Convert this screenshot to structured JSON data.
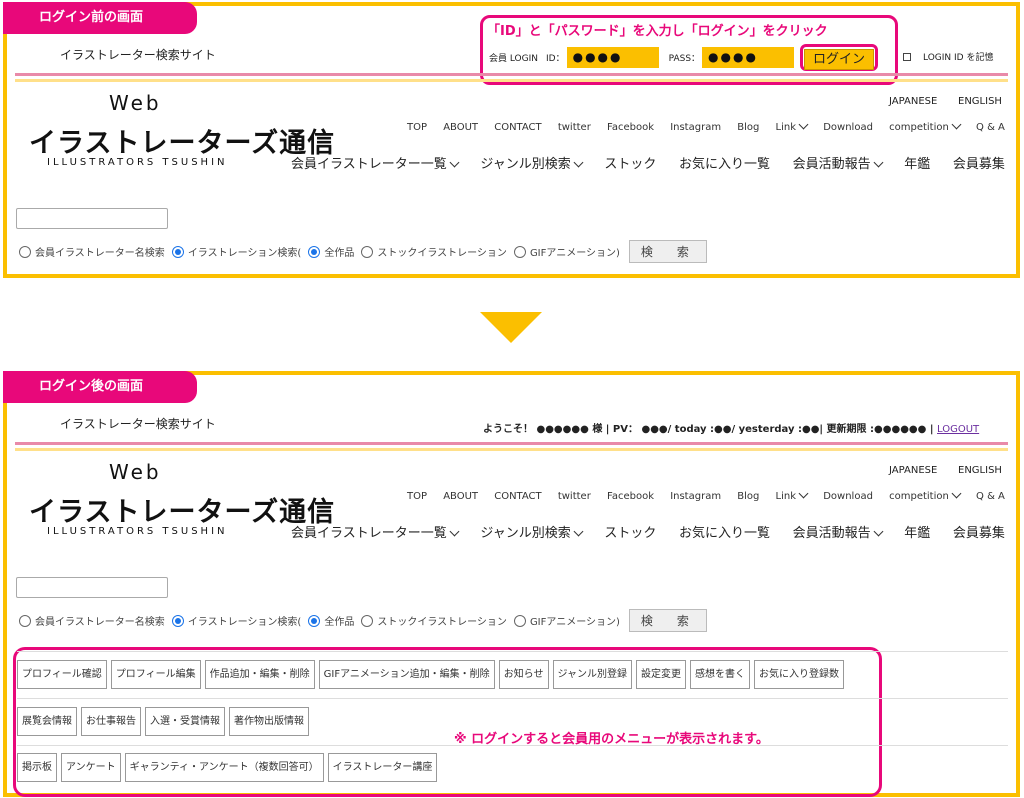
{
  "before": {
    "tag": "ログイン前の画面",
    "instruction": "「ID」と「パスワード」を入力し「ログイン」をクリック",
    "member_login_label": "会員 LOGIN",
    "id_label": "ID：",
    "id_value": "●●●●",
    "pass_label": "PASS：",
    "pass_value": "●●●●",
    "login_button": "ログイン",
    "remember_label": "LOGIN ID を記憶"
  },
  "after": {
    "tag": "ログイン後の画面",
    "welcome": "ようこそ！ ●●●●●● 様 | PV： ●●●/ today :●●/ yesterday :●●| 更新期限 :●●●●●● |",
    "logout": "LOGOUT",
    "menu_rows": [
      [
        "プロフィール確認",
        "プロフィール編集",
        "作品追加・編集・削除",
        "GIFアニメーション追加・編集・削除",
        "お知らせ",
        "ジャンル別登録",
        "設定変更",
        "感想を書く",
        "お気に入り登録数"
      ],
      [
        "展覧会情報",
        "お仕事報告",
        "入選・受賞情報",
        "著作物出版情報"
      ],
      [
        "掲示板",
        "アンケート",
        "ギャランティ・アンケート（複数回答可）",
        "イラストレーター講座"
      ]
    ],
    "note": "※ ログインすると会員用のメニューが表示されます。"
  },
  "site": {
    "tagline": "イラストレーター検索サイト",
    "logo_web": "Web",
    "logo_jp": "イラストレーターズ通信",
    "logo_en": "ILLUSTRATORS TSUSHIN",
    "lang_jp": "JAPANESE",
    "lang_en": "ENGLISH",
    "top_nav": [
      "TOP",
      "ABOUT",
      "CONTACT",
      "twitter",
      "Facebook",
      "Instagram",
      "Blog",
      "Link",
      "Download",
      "competition",
      "Q & A"
    ],
    "main_nav": [
      "会員イラストレーター一覧",
      "ジャンル別検索",
      "ストック",
      "お気に入り一覧",
      "会員活動報告",
      "年鑑",
      "会員募集"
    ],
    "search": {
      "opt_name": "会員イラストレーター名検索",
      "opt_illust": "イラストレーション検索(",
      "opt_all": "全作品",
      "opt_stock": "ストックイラストレーション",
      "opt_gif": "GIFアニメーション)",
      "button": "検　索"
    }
  },
  "colors": {
    "accent_pink": "#e8087a",
    "accent_yellow": "#fbbf00"
  }
}
